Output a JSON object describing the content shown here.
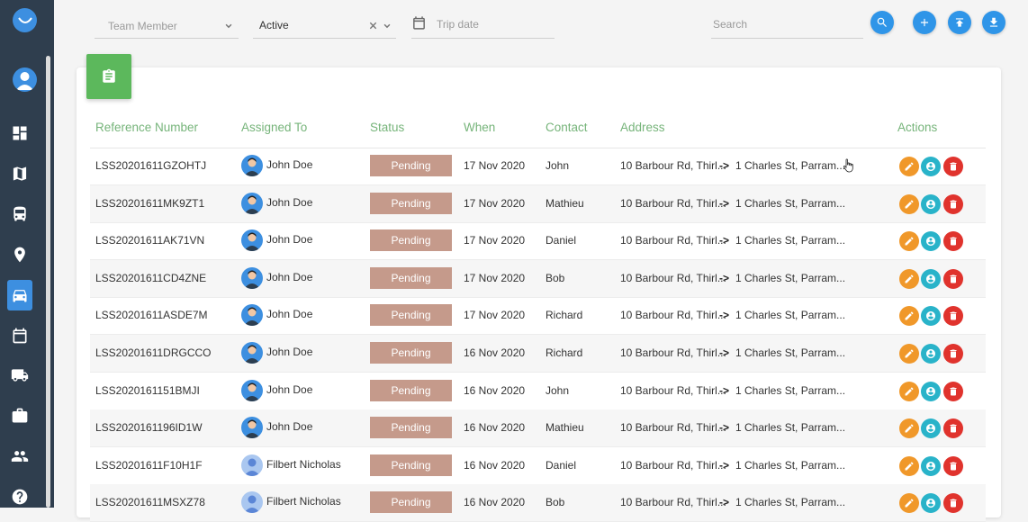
{
  "filters": {
    "team_member_placeholder": "Team Member",
    "status_value": "Active",
    "trip_date_placeholder": "Trip date",
    "search_placeholder": "Search"
  },
  "table": {
    "columns": [
      "Reference Number",
      "Assigned To",
      "Status",
      "When",
      "Contact",
      "Address",
      "Actions"
    ],
    "arrow": "->",
    "rows": [
      {
        "ref": "LSS20201611GZOHTJ",
        "assigned": "John Doe",
        "status": "Pending",
        "when": "17 Nov 2020",
        "contact": "John",
        "from": "10 Barbour Rd, Thirl...",
        "to": "1 Charles St, Parram..."
      },
      {
        "ref": "LSS20201611MK9ZT1",
        "assigned": "John Doe",
        "status": "Pending",
        "when": "17 Nov 2020",
        "contact": "Mathieu",
        "from": "10 Barbour Rd, Thirl...",
        "to": "1 Charles St, Parram..."
      },
      {
        "ref": "LSS20201611AK71VN",
        "assigned": "John Doe",
        "status": "Pending",
        "when": "17 Nov 2020",
        "contact": "Daniel",
        "from": "10 Barbour Rd, Thirl...",
        "to": "1 Charles St, Parram..."
      },
      {
        "ref": "LSS20201611CD4ZNE",
        "assigned": "John Doe",
        "status": "Pending",
        "when": "17 Nov 2020",
        "contact": "Bob",
        "from": "10 Barbour Rd, Thirl...",
        "to": "1 Charles St, Parram..."
      },
      {
        "ref": "LSS20201611ASDE7M",
        "assigned": "John Doe",
        "status": "Pending",
        "when": "17 Nov 2020",
        "contact": "Richard",
        "from": "10 Barbour Rd, Thirl...",
        "to": "1 Charles St, Parram..."
      },
      {
        "ref": "LSS20201611DRGCCO",
        "assigned": "John Doe",
        "status": "Pending",
        "when": "16 Nov 2020",
        "contact": "Richard",
        "from": "10 Barbour Rd, Thirl...",
        "to": "1 Charles St, Parram..."
      },
      {
        "ref": "LSS2020161151BMJI",
        "assigned": "John Doe",
        "status": "Pending",
        "when": "16 Nov 2020",
        "contact": "John",
        "from": "10 Barbour Rd, Thirl...",
        "to": "1 Charles St, Parram..."
      },
      {
        "ref": "LSS2020161196ID1W",
        "assigned": "John Doe",
        "status": "Pending",
        "when": "16 Nov 2020",
        "contact": "Mathieu",
        "from": "10 Barbour Rd, Thirl...",
        "to": "1 Charles St, Parram..."
      },
      {
        "ref": "LSS20201611F10H1F",
        "assigned": "Filbert Nicholas",
        "status": "Pending",
        "when": "16 Nov 2020",
        "contact": "Daniel",
        "from": "10 Barbour Rd, Thirl...",
        "to": "1 Charles St, Parram..."
      },
      {
        "ref": "LSS20201611MSXZ78",
        "assigned": "Filbert Nicholas",
        "status": "Pending",
        "when": "16 Nov 2020",
        "contact": "Bob",
        "from": "10 Barbour Rd, Thirl...",
        "to": "1 Charles St, Parram..."
      }
    ]
  },
  "colors": {
    "sidebar": "#2f3e4e",
    "accent": "#2f95e8",
    "header_text": "#76b47a",
    "status_pending": "#c59a8b",
    "edit": "#f0982a",
    "view": "#29b3c9",
    "delete": "#e0332d"
  },
  "icons": {
    "sidebar": [
      "dashboard-icon",
      "map-icon",
      "bus-icon",
      "location-pin-icon",
      "car-icon",
      "calendar-icon",
      "truck-icon",
      "briefcase-icon",
      "people-icon",
      "help-icon"
    ],
    "toolbar": [
      "search-icon",
      "add-icon",
      "upload-icon",
      "download-icon"
    ],
    "actions": [
      "edit-icon",
      "user-icon",
      "trash-icon"
    ]
  }
}
